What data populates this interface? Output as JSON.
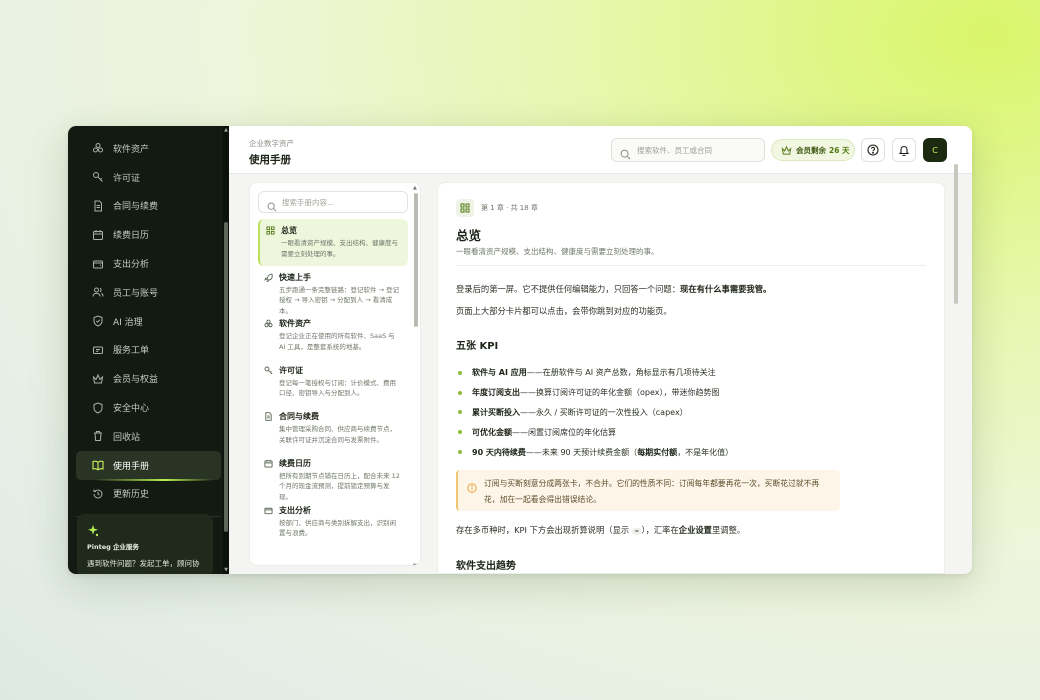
{
  "sidebar": {
    "items": [
      {
        "label": "软件资产",
        "icon": "boxes-icon"
      },
      {
        "label": "许可证",
        "icon": "key-icon"
      },
      {
        "label": "合同与续费",
        "icon": "document-icon"
      },
      {
        "label": "续费日历",
        "icon": "calendar-icon"
      },
      {
        "label": "支出分析",
        "icon": "wallet-icon"
      },
      {
        "label": "员工与账号",
        "icon": "users-icon"
      },
      {
        "label": "AI 治理",
        "icon": "shield-ai-icon"
      },
      {
        "label": "服务工单",
        "icon": "ticket-icon"
      },
      {
        "label": "会员与权益",
        "icon": "crown-icon"
      },
      {
        "label": "安全中心",
        "icon": "shield-icon"
      },
      {
        "label": "回收站",
        "icon": "trash-icon"
      },
      {
        "label": "使用手册",
        "icon": "book-icon",
        "active": true
      },
      {
        "label": "更新历史",
        "icon": "history-icon"
      }
    ],
    "promo": {
      "title": "Pinteg 企业服务",
      "text": "遇到软件问题？发起工单，顾问协"
    }
  },
  "header": {
    "breadcrumb": "企业数字资产",
    "title": "使用手册",
    "search_placeholder": "搜索软件、员工或合同",
    "member_label": "会员剩余",
    "member_days": "26 天",
    "avatar_letter": "C"
  },
  "toc": {
    "search_placeholder": "搜索手册内容...",
    "items": [
      {
        "title": "总览",
        "desc": "一眼看清资产规模、支出结构、健康度与需要立刻处理的事。",
        "icon": "grid-icon",
        "active": true
      },
      {
        "title": "快速上手",
        "desc": "五步跑通一条完整链路：登记软件 → 登记授权 → 导入密钥 → 分配到人 → 看清成本。",
        "icon": "rocket-icon"
      },
      {
        "title": "软件资产",
        "desc": "登记企业正在使用的所有软件、SaaS 与 AI 工具，是整套系统的地基。",
        "icon": "boxes-icon"
      },
      {
        "title": "许可证",
        "desc": "登记每一笔授权与订阅：计价模式、费用口径、密钥导入与分配到人。",
        "icon": "key-icon"
      },
      {
        "title": "合同与续费",
        "desc": "集中管理采购合同、供应商与续费节点，关联许可证并沉淀合同与发票附件。",
        "icon": "document-icon"
      },
      {
        "title": "续费日历",
        "desc": "把所有到期节点铺在日历上，配合未来 12 个月的现金流预测，提前锁定预算与发现。",
        "icon": "calendar-icon"
      },
      {
        "title": "支出分析",
        "desc": "按部门、供应商与类别拆解支出，识别闲置与浪费。",
        "icon": "wallet-icon"
      }
    ]
  },
  "article": {
    "chapter": "第 1 章 · 共 18 章",
    "title": "总览",
    "subtitle": "一眼看清资产规模、支出结构、健康度与需要立刻处理的事。",
    "p1_prefix": "登录后的第一屏。它不提供任何编辑能力，只回答一个问题：",
    "p1_bold": "现在有什么事需要我管。",
    "p2": "页面上大部分卡片都可以点击，会带你跳到对应的功能页。",
    "h_kpi": "五张 KPI",
    "kpis": [
      {
        "bold": "软件与 AI 应用",
        "text": "——在册软件与 AI 资产总数，角标显示有几项待关注"
      },
      {
        "bold": "年度订阅支出",
        "text": "——换算订阅许可证的年化金额（opex），带迷你趋势图"
      },
      {
        "bold": "累计买断投入",
        "text": "——永久 / 买断许可证的一次性投入（capex）"
      },
      {
        "bold": "可优化金额",
        "text": "——闲置订阅席位的年化估算"
      },
      {
        "bold": "90 天内待续费",
        "text": "——未来 90 天预计续费金额（",
        "bold2": "每期实付额",
        "tail": "，不是年化值）"
      }
    ],
    "callout": "订阅与买断刻意分成两张卡，不合并。它们的性质不同：订阅每年都要再花一次，买断花过就不再花，加在一起看会得出错误结论。",
    "p3_a": "存在多币种时，KPI 下方会出现折算说明（显示 ",
    "p3_code": "≈",
    "p3_b": "），汇率在",
    "p3_bold": "企业设置",
    "p3_c": "里调整。",
    "h_trend": "软件支出趋势"
  }
}
